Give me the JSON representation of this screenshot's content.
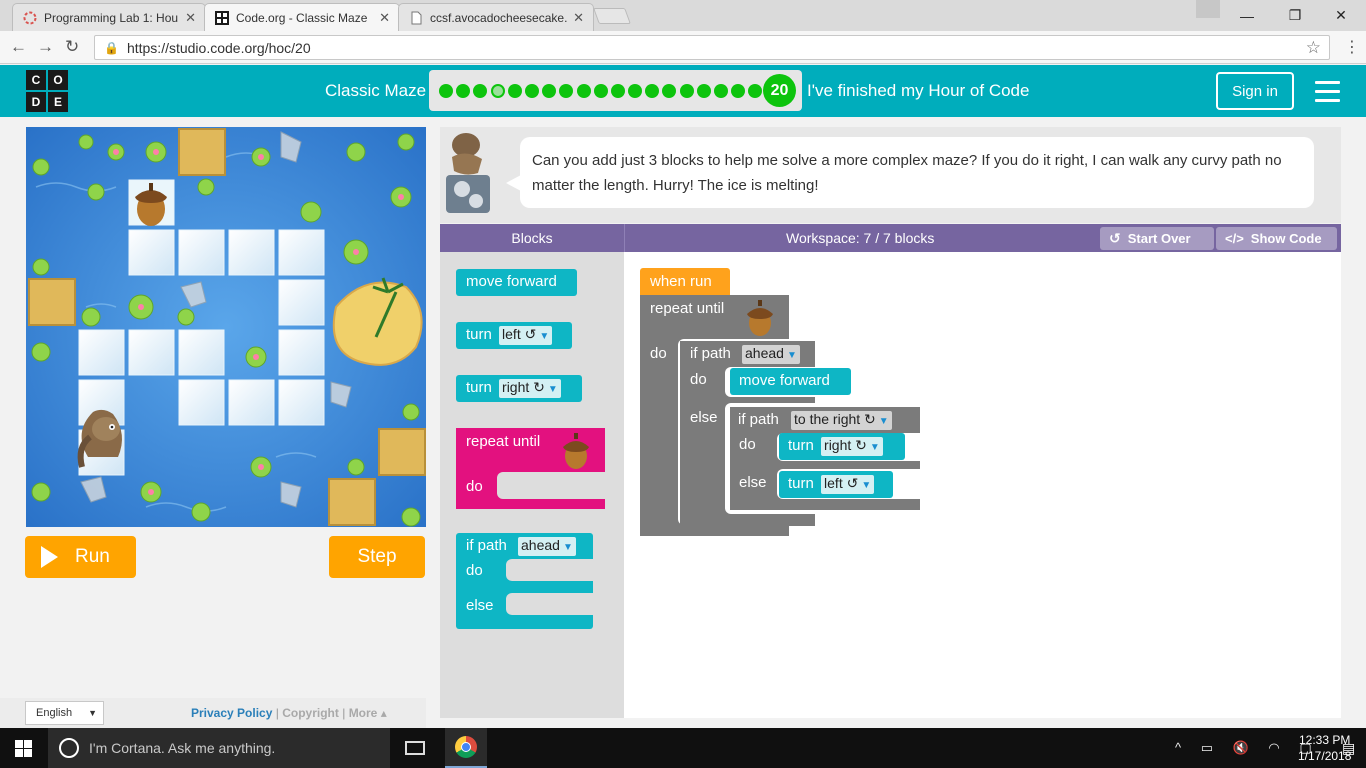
{
  "browser": {
    "tabs": [
      {
        "title": "Programming Lab 1: Hou",
        "active": false,
        "icon": "circle-loading-icon"
      },
      {
        "title": "Code.org - Classic Maze",
        "active": true,
        "icon": "codeorg-favicon-icon"
      },
      {
        "title": "ccsf.avocadocheesecake.",
        "active": false,
        "icon": "page-icon"
      }
    ],
    "tab_close": "✕",
    "url": "https://studio.code.org/hoc/20",
    "window_controls": {
      "minimize": "—",
      "maximize": "❐",
      "close": "✕"
    }
  },
  "header": {
    "logo_letters": [
      "C",
      "O",
      "D",
      "E"
    ],
    "title": "Classic Maze",
    "progress_total": 20,
    "current_dot_index": 3,
    "level_number": "20",
    "finished_link": "I've finished my Hour of Code",
    "signin_label": "Sign in"
  },
  "controls": {
    "run_label": "Run",
    "step_label": "Step"
  },
  "footer": {
    "language": "English",
    "privacy": "Privacy Policy",
    "separator": "|",
    "copyright": "Copyright",
    "more": "More ▴"
  },
  "instructions": {
    "text": "Can you add just 3 blocks to help me solve a more complex maze? If you do it right, I can walk any curvy path no matter the length. Hurry! The ice is melting!"
  },
  "workspace_header": {
    "blocks_title": "Blocks",
    "workspace_count": "Workspace: 7 / 7 blocks",
    "start_over": "Start Over",
    "show_code": "Show Code"
  },
  "toolbox": {
    "move_forward": "move forward",
    "turn": "turn",
    "left_opt": "left ↺",
    "right_opt": "right ↻",
    "repeat_until": "repeat until",
    "do": "do",
    "if_path": "if path",
    "ahead_opt": "ahead",
    "else": "else"
  },
  "program": {
    "when_run": "when run",
    "repeat_until": "repeat until",
    "do": "do",
    "if_path": "if path",
    "ahead_opt": "ahead",
    "move_forward": "move forward",
    "else": "else",
    "to_the_right_opt": "to the right ↻",
    "turn": "turn",
    "right_opt": "right ↻",
    "left_opt": "left ↺"
  },
  "taskbar": {
    "cortana_placeholder": "I'm Cortana. Ask me anything.",
    "time": "12:33 PM",
    "date": "1/17/2018"
  },
  "colors": {
    "header_teal": "#00adbc",
    "progress_green": "#0dc40d",
    "run_orange": "#ffa400",
    "workspace_purple": "#7665a0",
    "block_teal": "#0eb6c5",
    "block_pink": "#e3117f",
    "block_gray": "#7b7b7b",
    "when_run_orange": "#ffa21c"
  }
}
